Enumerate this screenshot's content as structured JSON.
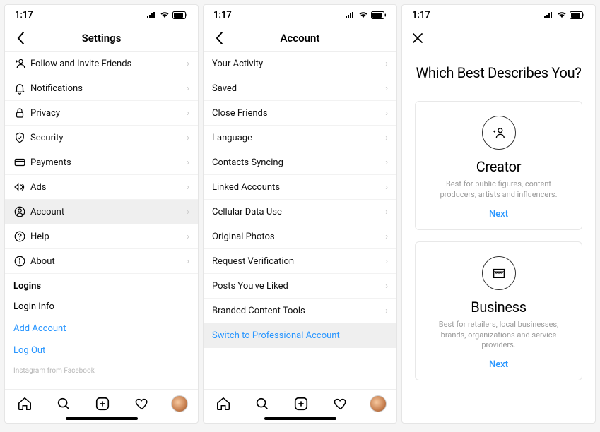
{
  "status": {
    "time": "1:17"
  },
  "screen1": {
    "title": "Settings",
    "items": [
      {
        "label": "Follow and Invite Friends"
      },
      {
        "label": "Notifications"
      },
      {
        "label": "Privacy"
      },
      {
        "label": "Security"
      },
      {
        "label": "Payments"
      },
      {
        "label": "Ads"
      },
      {
        "label": "Account"
      },
      {
        "label": "Help"
      },
      {
        "label": "About"
      }
    ],
    "logins_section": "Logins",
    "login_info": "Login Info",
    "add_account": "Add Account",
    "log_out": "Log Out",
    "footer": "Instagram from Facebook"
  },
  "screen2": {
    "title": "Account",
    "items": [
      {
        "label": "Your Activity"
      },
      {
        "label": "Saved"
      },
      {
        "label": "Close Friends"
      },
      {
        "label": "Language"
      },
      {
        "label": "Contacts Syncing"
      },
      {
        "label": "Linked Accounts"
      },
      {
        "label": "Cellular Data Use"
      },
      {
        "label": "Original Photos"
      },
      {
        "label": "Request Verification"
      },
      {
        "label": "Posts You've Liked"
      },
      {
        "label": "Branded Content Tools"
      },
      {
        "label": "Switch to Professional Account"
      }
    ]
  },
  "screen3": {
    "heading": "Which Best Describes You?",
    "creator": {
      "title": "Creator",
      "desc": "Best for public figures, content producers, artists and influencers.",
      "next": "Next"
    },
    "business": {
      "title": "Business",
      "desc": "Best for retailers, local businesses, brands, organizations and service providers.",
      "next": "Next"
    }
  }
}
